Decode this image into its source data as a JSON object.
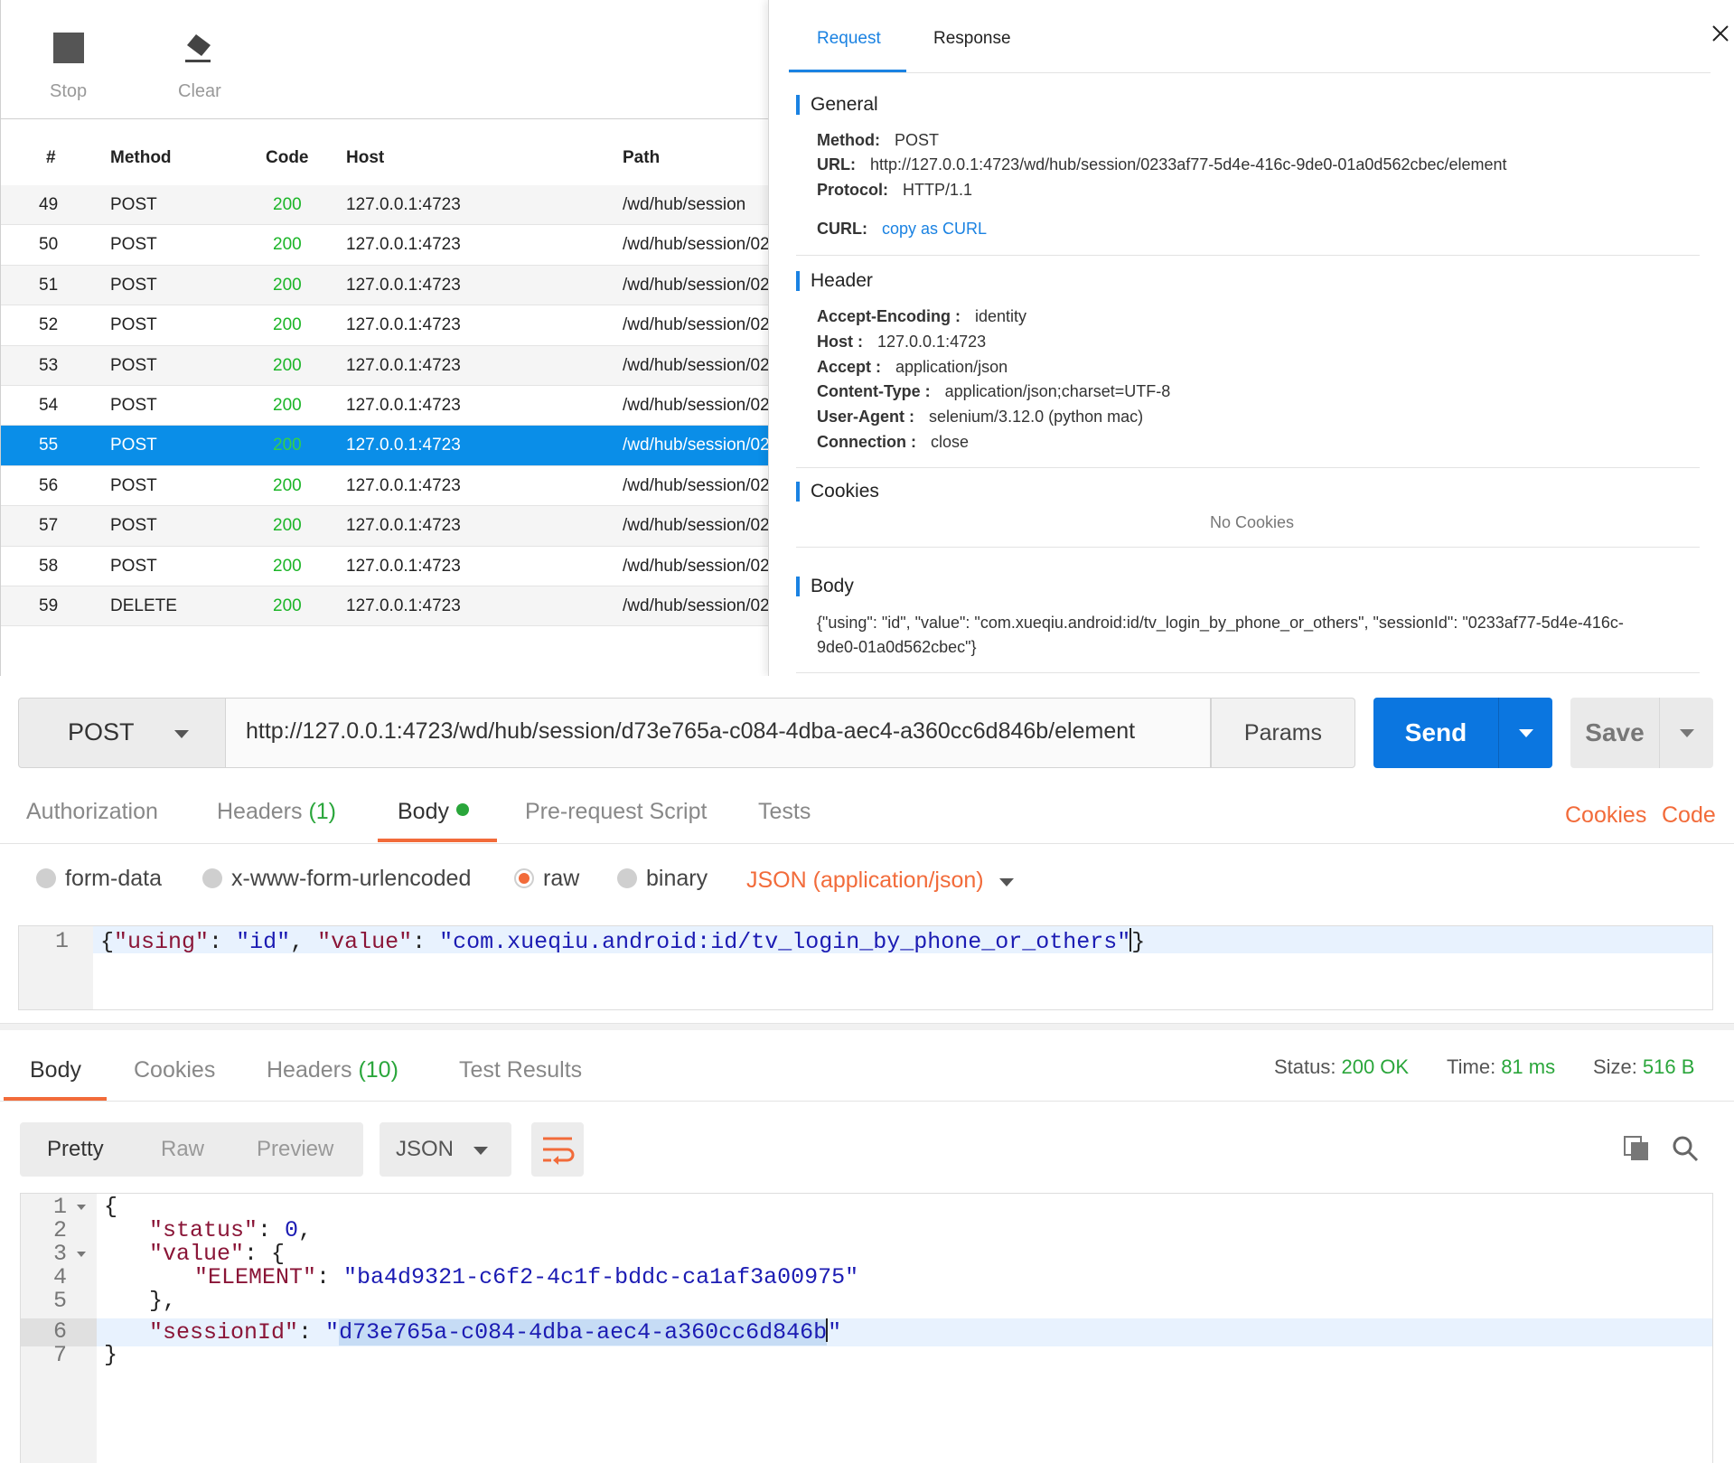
{
  "proxy": {
    "toolbar": {
      "stop_label": "Stop",
      "clear_label": "Clear"
    },
    "table": {
      "headers": {
        "num": "#",
        "method": "Method",
        "code": "Code",
        "host": "Host",
        "path": "Path"
      },
      "rows": [
        {
          "num": "49",
          "method": "POST",
          "code": "200",
          "host": "127.0.0.1:4723",
          "path": "/wd/hub/session"
        },
        {
          "num": "50",
          "method": "POST",
          "code": "200",
          "host": "127.0.0.1:4723",
          "path": "/wd/hub/session/02"
        },
        {
          "num": "51",
          "method": "POST",
          "code": "200",
          "host": "127.0.0.1:4723",
          "path": "/wd/hub/session/02"
        },
        {
          "num": "52",
          "method": "POST",
          "code": "200",
          "host": "127.0.0.1:4723",
          "path": "/wd/hub/session/02"
        },
        {
          "num": "53",
          "method": "POST",
          "code": "200",
          "host": "127.0.0.1:4723",
          "path": "/wd/hub/session/02"
        },
        {
          "num": "54",
          "method": "POST",
          "code": "200",
          "host": "127.0.0.1:4723",
          "path": "/wd/hub/session/02"
        },
        {
          "num": "55",
          "method": "POST",
          "code": "200",
          "host": "127.0.0.1:4723",
          "path": "/wd/hub/session/02",
          "selected": true
        },
        {
          "num": "56",
          "method": "POST",
          "code": "200",
          "host": "127.0.0.1:4723",
          "path": "/wd/hub/session/02"
        },
        {
          "num": "57",
          "method": "POST",
          "code": "200",
          "host": "127.0.0.1:4723",
          "path": "/wd/hub/session/02"
        },
        {
          "num": "58",
          "method": "POST",
          "code": "200",
          "host": "127.0.0.1:4723",
          "path": "/wd/hub/session/02"
        },
        {
          "num": "59",
          "method": "DELETE",
          "code": "200",
          "host": "127.0.0.1:4723",
          "path": "/wd/hub/session/02"
        }
      ]
    },
    "detail": {
      "tabs": {
        "request": "Request",
        "response": "Response"
      },
      "general": {
        "title": "General",
        "method_label": "Method:",
        "method_value": "POST",
        "url_label": "URL:",
        "url_value": "http://127.0.0.1:4723/wd/hub/session/0233af77-5d4e-416c-9de0-01a0d562cbec/element",
        "protocol_label": "Protocol:",
        "protocol_value": "HTTP/1.1",
        "curl_label": "CURL:",
        "curl_link": "copy as CURL"
      },
      "header": {
        "title": "Header",
        "items": [
          {
            "key": "Accept-Encoding :",
            "value": "identity"
          },
          {
            "key": "Host :",
            "value": "127.0.0.1:4723"
          },
          {
            "key": "Accept :",
            "value": "application/json"
          },
          {
            "key": "Content-Type :",
            "value": "application/json;charset=UTF-8"
          },
          {
            "key": "User-Agent :",
            "value": "selenium/3.12.0 (python mac)"
          },
          {
            "key": "Connection :",
            "value": "close"
          }
        ]
      },
      "cookies": {
        "title": "Cookies",
        "empty": "No Cookies"
      },
      "body": {
        "title": "Body",
        "text": "{\"using\": \"id\", \"value\": \"com.xueqiu.android:id/tv_login_by_phone_or_others\", \"sessionId\": \"0233af77-5d4e-416c-9de0-01a0d562cbec\"}"
      }
    }
  },
  "postman": {
    "method": "POST",
    "url": "http://127.0.0.1:4723/wd/hub/session/d73e765a-c084-4dba-aec4-a360cc6d846b/element",
    "params_label": "Params",
    "send_label": "Send",
    "save_label": "Save",
    "request_tabs": {
      "authorization": "Authorization",
      "headers": "Headers",
      "headers_count": "(1)",
      "body": "Body",
      "prerequest": "Pre-request Script",
      "tests": "Tests"
    },
    "links": {
      "cookies": "Cookies",
      "code": "Code"
    },
    "body_types": {
      "form_data": "form-data",
      "urlencoded": "x-www-form-urlencoded",
      "raw": "raw",
      "binary": "binary",
      "content_type": "JSON (application/json)"
    },
    "request_body": {
      "line_number": "1",
      "k1": "\"using\"",
      "v1": "\"id\"",
      "k2": "\"value\"",
      "v2": "\"com.xueqiu.android:id/tv_login_by_phone_or_others\""
    },
    "response_tabs": {
      "body": "Body",
      "cookies": "Cookies",
      "headers": "Headers",
      "headers_count": "(10)",
      "test_results": "Test Results"
    },
    "status": {
      "status_label": "Status:",
      "status_value": "200 OK",
      "time_label": "Time:",
      "time_value": "81 ms",
      "size_label": "Size:",
      "size_value": "516 B"
    },
    "view": {
      "pretty": "Pretty",
      "raw": "Raw",
      "preview": "Preview",
      "format": "JSON"
    },
    "response_body": {
      "line_numbers": [
        "1",
        "2",
        "3",
        "4",
        "5",
        "6",
        "7"
      ],
      "open_brace": "{",
      "status_key": "\"status\"",
      "status_val": "0",
      "value_key": "\"value\"",
      "element_key": "\"ELEMENT\"",
      "element_val": "\"ba4d9321-c6f2-4c1f-bddc-ca1af3a00975\"",
      "close_inner": "},",
      "session_key": "\"sessionId\"",
      "session_val": "d73e765a-c084-4dba-aec4-a360cc6d846b",
      "close_brace": "}"
    }
  }
}
